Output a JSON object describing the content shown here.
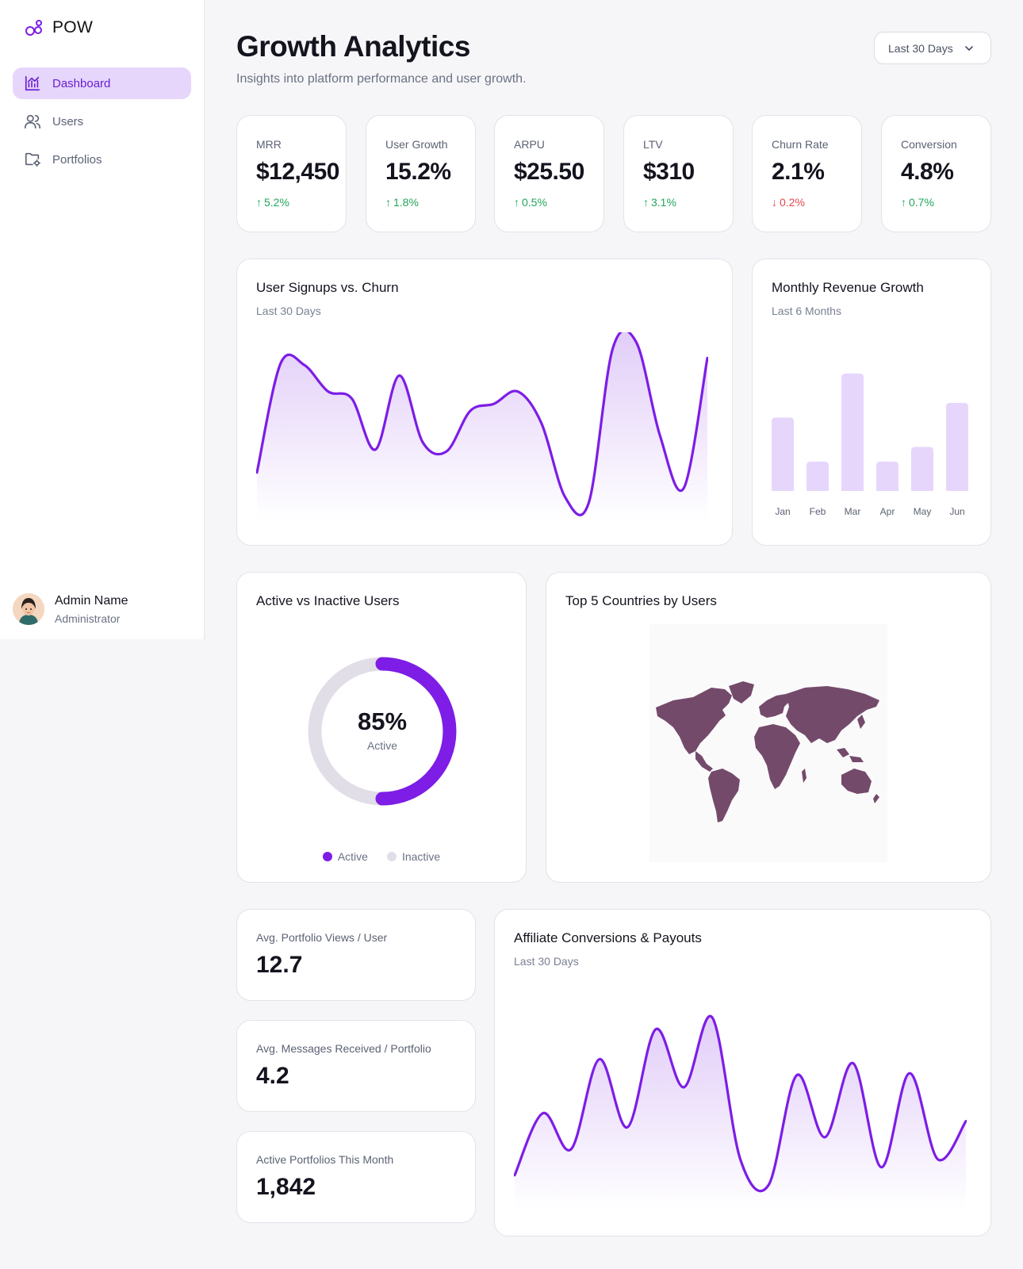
{
  "sidebar": {
    "brand": "POW",
    "items": [
      {
        "label": "Dashboard",
        "icon": "chart-line-icon",
        "active": true
      },
      {
        "label": "Users",
        "icon": "users-icon",
        "active": false
      },
      {
        "label": "Portfolios",
        "icon": "folder-settings-icon",
        "active": false
      }
    ],
    "profile": {
      "name": "Admin Name",
      "role": "Administrator"
    }
  },
  "header": {
    "title": "Growth Analytics",
    "subtitle": "Insights into platform performance and user growth.",
    "range": "Last 30 Days"
  },
  "kpis": [
    {
      "label": "MRR",
      "value": "$12,450",
      "delta": "5.2%",
      "direction": "up"
    },
    {
      "label": "User Growth",
      "value": "15.2%",
      "delta": "1.8%",
      "direction": "up"
    },
    {
      "label": "ARPU",
      "value": "$25.50",
      "delta": "0.5%",
      "direction": "up"
    },
    {
      "label": "LTV",
      "value": "$310",
      "delta": "3.1%",
      "direction": "up"
    },
    {
      "label": "Churn Rate",
      "value": "2.1%",
      "delta": "0.2%",
      "direction": "down"
    },
    {
      "label": "Conversion",
      "value": "4.8%",
      "delta": "0.7%",
      "direction": "up"
    }
  ],
  "signups": {
    "title": "User Signups vs. Churn",
    "subtitle": "Last 30 Days"
  },
  "revenue": {
    "title": "Monthly Revenue Growth",
    "subtitle": "Last 6 Months"
  },
  "active_users": {
    "title": "Active vs Inactive Users",
    "percent": "85%",
    "center_label": "Active",
    "legend": [
      "Active",
      "Inactive"
    ]
  },
  "countries": {
    "title": "Top 5 Countries by Users"
  },
  "stats": [
    {
      "label": "Avg. Portfolio Views / User",
      "value": "12.7"
    },
    {
      "label": "Avg. Messages Received / Portfolio",
      "value": "4.2"
    },
    {
      "label": "Active Portfolios This Month",
      "value": "1,842"
    }
  ],
  "affiliate": {
    "title": "Affiliate Conversions & Payouts",
    "subtitle": "Last 30 Days"
  },
  "colors": {
    "accent": "#7d1de6",
    "accent_light": "#e6d6fb",
    "up": "#22a55a",
    "down": "#e5484d",
    "map": "#744a6b"
  },
  "chart_data": [
    {
      "type": "area",
      "title": "User Signups vs. Churn",
      "x": [
        0,
        1,
        2,
        3,
        4,
        5,
        6,
        7,
        8,
        9,
        10,
        11,
        12,
        13,
        14,
        15,
        16,
        17,
        18,
        19
      ],
      "values": [
        24,
        86,
        85,
        70,
        66,
        37,
        79,
        41,
        36,
        59,
        63,
        70,
        52,
        10,
        7,
        94,
        98,
        45,
        15,
        89
      ]
    },
    {
      "type": "bar",
      "title": "Monthly Revenue Growth",
      "categories": [
        "Jan",
        "Feb",
        "Mar",
        "Apr",
        "May",
        "Jun"
      ],
      "values": [
        50,
        20,
        80,
        20,
        30,
        60
      ],
      "ylim": [
        0,
        100
      ]
    },
    {
      "type": "pie",
      "title": "Active vs Inactive Users",
      "categories": [
        "Active",
        "Inactive"
      ],
      "values": [
        85,
        15
      ]
    },
    {
      "type": "area",
      "title": "Affiliate Conversions & Payouts",
      "x": [
        0,
        1,
        2,
        3,
        4,
        5,
        6,
        7,
        8,
        9,
        10,
        11,
        12,
        13,
        14,
        15,
        16
      ],
      "values": [
        14,
        45,
        27,
        72,
        38,
        87,
        58,
        93,
        22,
        9,
        64,
        33,
        70,
        18,
        65,
        22,
        41
      ]
    }
  ]
}
